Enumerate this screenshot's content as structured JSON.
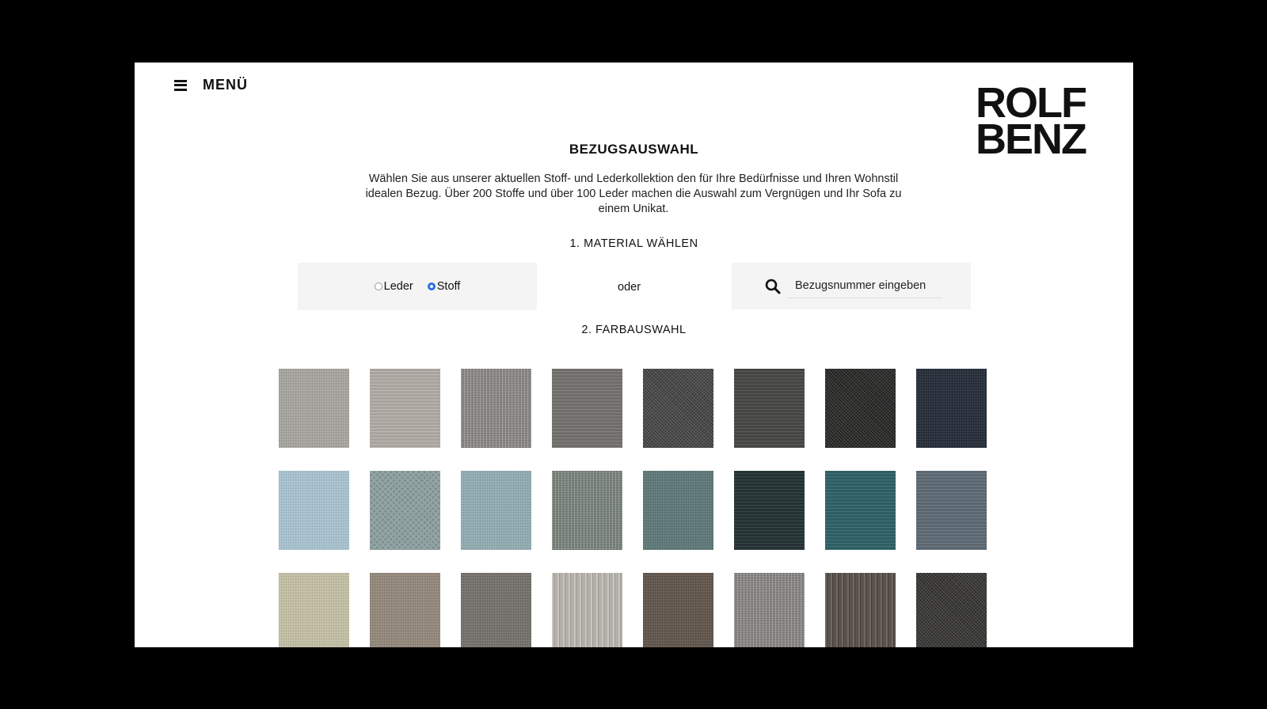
{
  "header": {
    "menu_label": "MENÜ",
    "logo_line1": "ROLF",
    "logo_line2": "BENZ"
  },
  "main": {
    "title": "BEZUGSAUSWAHL",
    "intro": "Wählen Sie aus unserer aktuellen Stoff- und Lederkollektion den für Ihre Bedürfnisse und Ihren Wohnstil idealen Bezug. Über 200 Stoffe und über 100 Leder machen die Auswahl zum Vergnügen und Ihr Sofa zu einem Unikat.",
    "step1_label": "1. MATERIAL WÄHLEN",
    "material_options": [
      {
        "label": "Leder",
        "checked": false
      },
      {
        "label": "Stoff",
        "checked": true
      }
    ],
    "or_label": "oder",
    "search_placeholder": "Bezugsnummer eingeben",
    "step2_label": "2. FARBAUSWAHL"
  },
  "colors": {
    "accent": "#2a6fe0",
    "panel_bg": "#f4f4f4"
  },
  "swatches": [
    {
      "color": "#9e9c97",
      "texture": "fine"
    },
    {
      "color": "#a8a49d",
      "texture": "plain"
    },
    {
      "color": "#8b8a86",
      "texture": "tweed"
    },
    {
      "color": "#6e6d69",
      "texture": "plain"
    },
    {
      "color": "#4a4a4a",
      "texture": "boucle"
    },
    {
      "color": "#454543",
      "texture": "plain"
    },
    {
      "color": "#2f2f2e",
      "texture": "boucle"
    },
    {
      "color": "#232c37",
      "texture": "fine"
    },
    {
      "color": "#9fb8c3",
      "texture": "fine"
    },
    {
      "color": "#7e8f90",
      "texture": "check"
    },
    {
      "color": "#8aa3a8",
      "texture": "fine"
    },
    {
      "color": "#7c857e",
      "texture": "tweed"
    },
    {
      "color": "#5a7372",
      "texture": "fine"
    },
    {
      "color": "#253234",
      "texture": "plain"
    },
    {
      "color": "#2f5e62",
      "texture": "plain"
    },
    {
      "color": "#5a6670",
      "texture": "plain"
    },
    {
      "color": "#b8b59c",
      "texture": "fine"
    },
    {
      "color": "#8b8275",
      "texture": "fine"
    },
    {
      "color": "#6f6c68",
      "texture": "fine"
    },
    {
      "color": "#b3b0aa",
      "texture": "stripe"
    },
    {
      "color": "#5c524a",
      "texture": "fine"
    },
    {
      "color": "#8a8886",
      "texture": "tweed"
    },
    {
      "color": "#5a524b",
      "texture": "stripe"
    },
    {
      "color": "#3c3b39",
      "texture": "boucle"
    }
  ]
}
